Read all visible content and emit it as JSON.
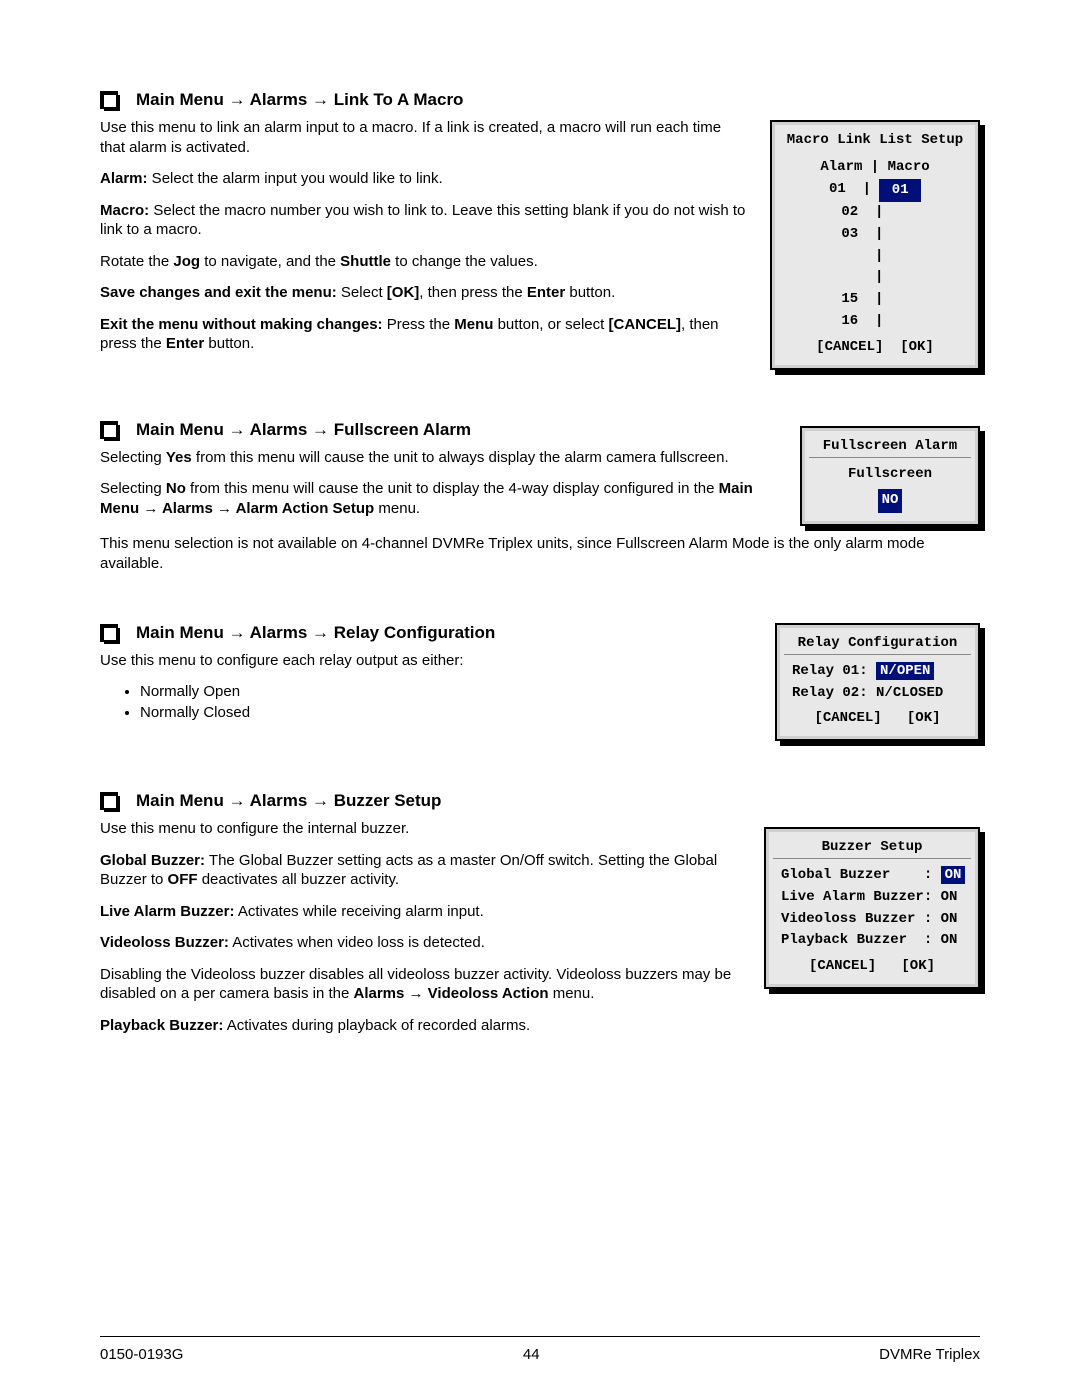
{
  "arrow": "→",
  "sections": {
    "link_macro": {
      "heading": "Main Menu → Alarms → Link To A Macro",
      "p1": "Use this menu to link an alarm input to a macro.  If a link is created, a macro will run each time that alarm is activated.",
      "p2a": "Alarm:",
      "p2b": "  Select the alarm input you would like to link.",
      "p3a": "Macro:",
      "p3b": "  Select the macro number you wish to link to.  Leave this setting blank if you do not wish to link to a macro.",
      "p4a": "Rotate the ",
      "p4b": "Jog",
      "p4c": " to navigate, and the ",
      "p4d": "Shuttle",
      "p4e": " to change the values.",
      "p5a": "Save changes and exit the menu:",
      "p5b": "  Select ",
      "p5c": "[OK]",
      "p5d": ", then press the ",
      "p5e": "Enter",
      "p5f": " button.",
      "p6a": "Exit the menu without making changes:",
      "p6b": "  Press the ",
      "p6c": "Menu",
      "p6d": " button, or select ",
      "p6e": "[CANCEL]",
      "p6f": ", then press the ",
      "p6g": "Enter",
      "p6h": " button.",
      "panel": {
        "title": "Macro Link List Setup",
        "head_l": "Alarm",
        "head_sep": " | ",
        "head_r": "Macro",
        "rows": [
          {
            "a": "01",
            "m": "01",
            "sel": true
          },
          {
            "a": "02",
            "m": "",
            "sel": false
          },
          {
            "a": "03",
            "m": "",
            "sel": false
          },
          {
            "a": "",
            "m": "",
            "sel": false
          },
          {
            "a": "",
            "m": "",
            "sel": false
          },
          {
            "a": "15",
            "m": "",
            "sel": false
          },
          {
            "a": "16",
            "m": "",
            "sel": false
          }
        ],
        "btn_cancel": "[CANCEL]",
        "btn_ok": "[OK]"
      }
    },
    "fullscreen": {
      "heading": "Main Menu → Alarms → Fullscreen Alarm",
      "p1a": "Selecting ",
      "p1b": "Yes",
      "p1c": " from this menu will cause the unit to always display the alarm camera fullscreen.",
      "p2a": "Selecting ",
      "p2b": "No",
      "p2c": " from this menu will cause the unit to display the 4-way display configured in the ",
      "p2d": "Main Menu → Alarms → Alarm Action Setup",
      "p2e": " menu.",
      "p3": "This menu selection is not available on 4-channel DVMRe Triplex units, since Fullscreen Alarm Mode is the only alarm mode available.",
      "panel": {
        "title": "Fullscreen Alarm",
        "label": "Fullscreen",
        "value": "NO"
      }
    },
    "relay": {
      "heading": "Main Menu → Alarms → Relay Configuration",
      "p1": "Use this menu to configure each relay output as either:",
      "b1": "Normally Open",
      "b2": "Normally Closed",
      "panel": {
        "title": "Relay Configuration",
        "r1_label": "Relay 01:",
        "r1_val": "N/OPEN",
        "r2_label": "Relay 02:",
        "r2_val": "N/CLOSED",
        "btn_cancel": "[CANCEL]",
        "btn_ok": "[OK]"
      }
    },
    "buzzer": {
      "heading": "Main Menu → Alarms → Buzzer Setup",
      "p1": "Use this menu to configure the internal buzzer.",
      "p2a": "Global Buzzer:",
      "p2b": "  The Global Buzzer setting acts as a master On/Off switch.  Setting the Global Buzzer to ",
      "p2c": "OFF",
      "p2d": " deactivates all buzzer activity.",
      "p3a": "Live Alarm Buzzer:",
      "p3b": "  Activates while receiving alarm input.",
      "p4a": "Videoloss Buzzer:",
      "p4b": "  Activates when video loss is detected.",
      "p5a": "Disabling the Videoloss buzzer disables all videoloss buzzer activity. Videoloss buzzers may be disabled on a per camera basis in the ",
      "p5b": "Alarms → Videoloss Action",
      "p5c": " menu.",
      "p6a": "Playback Buzzer:",
      "p6b": "  Activates during playback of recorded alarms.",
      "panel": {
        "title": "Buzzer Setup",
        "l1": "Global Buzzer    :",
        "v1": "ON",
        "l2": "Live Alarm Buzzer:",
        "v2": "ON",
        "l3": "Videoloss Buzzer :",
        "v3": "ON",
        "l4": "Playback Buzzer  :",
        "v4": "ON",
        "btn_cancel": "[CANCEL]",
        "btn_ok": "[OK]"
      }
    }
  },
  "footer": {
    "left": "0150-0193G",
    "center": "44",
    "right": "DVMRe Triplex"
  }
}
